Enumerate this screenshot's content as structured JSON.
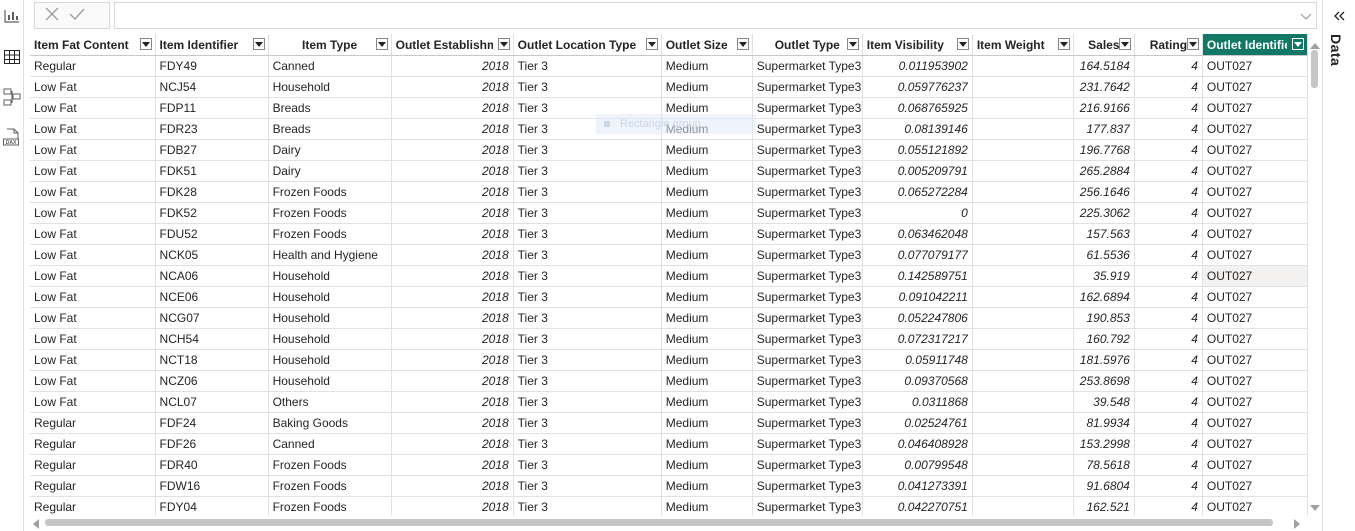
{
  "left_rail": {
    "items": [
      {
        "name": "report-view-icon"
      },
      {
        "name": "table-view-icon"
      },
      {
        "name": "model-view-icon"
      },
      {
        "name": "dax-query-view-icon",
        "label": "DAX"
      }
    ]
  },
  "formula_bar": {
    "cancel_icon": "close-icon",
    "commit_icon": "checkmark-icon",
    "value": ""
  },
  "ghost_overlay": {
    "label": "Rectangle group"
  },
  "table": {
    "columns": [
      {
        "label": "Item Fat Content",
        "align": "left"
      },
      {
        "label": "Item Identifier",
        "align": "left"
      },
      {
        "label": "Item Type",
        "align": "center"
      },
      {
        "label": "Outlet Establishment Year",
        "align": "left"
      },
      {
        "label": "Outlet Location Type",
        "align": "left"
      },
      {
        "label": "Outlet Size",
        "align": "left"
      },
      {
        "label": "Outlet Type",
        "align": "center"
      },
      {
        "label": "Item Visibility",
        "align": "left"
      },
      {
        "label": "Item Weight",
        "align": "left"
      },
      {
        "label": "Sales",
        "align": "center"
      },
      {
        "label": "Rating",
        "align": "center"
      },
      {
        "label": "Outlet Identifier",
        "align": "left",
        "selected": true
      }
    ],
    "rows": [
      [
        "Regular",
        "FDY49",
        "Canned",
        "2018",
        "Tier 3",
        "Medium",
        "Supermarket Type3",
        "0.011953902",
        "",
        "164.5184",
        "4",
        "OUT027"
      ],
      [
        "Low Fat",
        "NCJ54",
        "Household",
        "2018",
        "Tier 3",
        "Medium",
        "Supermarket Type3",
        "0.059776237",
        "",
        "231.7642",
        "4",
        "OUT027"
      ],
      [
        "Low Fat",
        "FDP11",
        "Breads",
        "2018",
        "Tier 3",
        "Medium",
        "Supermarket Type3",
        "0.068765925",
        "",
        "216.9166",
        "4",
        "OUT027"
      ],
      [
        "Low Fat",
        "FDR23",
        "Breads",
        "2018",
        "Tier 3",
        "Medium",
        "Supermarket Type3",
        "0.08139146",
        "",
        "177.837",
        "4",
        "OUT027"
      ],
      [
        "Low Fat",
        "FDB27",
        "Dairy",
        "2018",
        "Tier 3",
        "Medium",
        "Supermarket Type3",
        "0.055121892",
        "",
        "196.7768",
        "4",
        "OUT027"
      ],
      [
        "Low Fat",
        "FDK51",
        "Dairy",
        "2018",
        "Tier 3",
        "Medium",
        "Supermarket Type3",
        "0.005209791",
        "",
        "265.2884",
        "4",
        "OUT027"
      ],
      [
        "Low Fat",
        "FDK28",
        "Frozen Foods",
        "2018",
        "Tier 3",
        "Medium",
        "Supermarket Type3",
        "0.065272284",
        "",
        "256.1646",
        "4",
        "OUT027"
      ],
      [
        "Low Fat",
        "FDK52",
        "Frozen Foods",
        "2018",
        "Tier 3",
        "Medium",
        "Supermarket Type3",
        "0",
        "",
        "225.3062",
        "4",
        "OUT027"
      ],
      [
        "Low Fat",
        "FDU52",
        "Frozen Foods",
        "2018",
        "Tier 3",
        "Medium",
        "Supermarket Type3",
        "0.063462048",
        "",
        "157.563",
        "4",
        "OUT027"
      ],
      [
        "Low Fat",
        "NCK05",
        "Health and Hygiene",
        "2018",
        "Tier 3",
        "Medium",
        "Supermarket Type3",
        "0.077079177",
        "",
        "61.5536",
        "4",
        "OUT027"
      ],
      [
        "Low Fat",
        "NCA06",
        "Household",
        "2018",
        "Tier 3",
        "Medium",
        "Supermarket Type3",
        "0.142589751",
        "",
        "35.919",
        "4",
        "OUT027"
      ],
      [
        "Low Fat",
        "NCE06",
        "Household",
        "2018",
        "Tier 3",
        "Medium",
        "Supermarket Type3",
        "0.091042211",
        "",
        "162.6894",
        "4",
        "OUT027"
      ],
      [
        "Low Fat",
        "NCG07",
        "Household",
        "2018",
        "Tier 3",
        "Medium",
        "Supermarket Type3",
        "0.052247806",
        "",
        "190.853",
        "4",
        "OUT027"
      ],
      [
        "Low Fat",
        "NCH54",
        "Household",
        "2018",
        "Tier 3",
        "Medium",
        "Supermarket Type3",
        "0.072317217",
        "",
        "160.792",
        "4",
        "OUT027"
      ],
      [
        "Low Fat",
        "NCT18",
        "Household",
        "2018",
        "Tier 3",
        "Medium",
        "Supermarket Type3",
        "0.05911748",
        "",
        "181.5976",
        "4",
        "OUT027"
      ],
      [
        "Low Fat",
        "NCZ06",
        "Household",
        "2018",
        "Tier 3",
        "Medium",
        "Supermarket Type3",
        "0.09370568",
        "",
        "253.8698",
        "4",
        "OUT027"
      ],
      [
        "Low Fat",
        "NCL07",
        "Others",
        "2018",
        "Tier 3",
        "Medium",
        "Supermarket Type3",
        "0.0311868",
        "",
        "39.548",
        "4",
        "OUT027"
      ],
      [
        "Regular",
        "FDF24",
        "Baking Goods",
        "2018",
        "Tier 3",
        "Medium",
        "Supermarket Type3",
        "0.02524761",
        "",
        "81.9934",
        "4",
        "OUT027"
      ],
      [
        "Regular",
        "FDF26",
        "Canned",
        "2018",
        "Tier 3",
        "Medium",
        "Supermarket Type3",
        "0.046408928",
        "",
        "153.2998",
        "4",
        "OUT027"
      ],
      [
        "Regular",
        "FDR40",
        "Frozen Foods",
        "2018",
        "Tier 3",
        "Medium",
        "Supermarket Type3",
        "0.00799548",
        "",
        "78.5618",
        "4",
        "OUT027"
      ],
      [
        "Regular",
        "FDW16",
        "Frozen Foods",
        "2018",
        "Tier 3",
        "Medium",
        "Supermarket Type3",
        "0.041273391",
        "",
        "91.6804",
        "4",
        "OUT027"
      ],
      [
        "Regular",
        "FDY04",
        "Frozen Foods",
        "2018",
        "Tier 3",
        "Medium",
        "Supermarket Type3",
        "0.042270751",
        "",
        "162.521",
        "4",
        "OUT027"
      ]
    ],
    "numeric_columns": [
      3,
      7,
      8,
      9,
      10
    ],
    "hovered_row": 10
  },
  "right_pane": {
    "label": "Data",
    "collapse_icon": "double-chevron-left-icon"
  },
  "colors": {
    "selected_header": "#117865",
    "grid_line": "#e1e1e1",
    "scrollbar_thumb": "#c8c6c4"
  }
}
